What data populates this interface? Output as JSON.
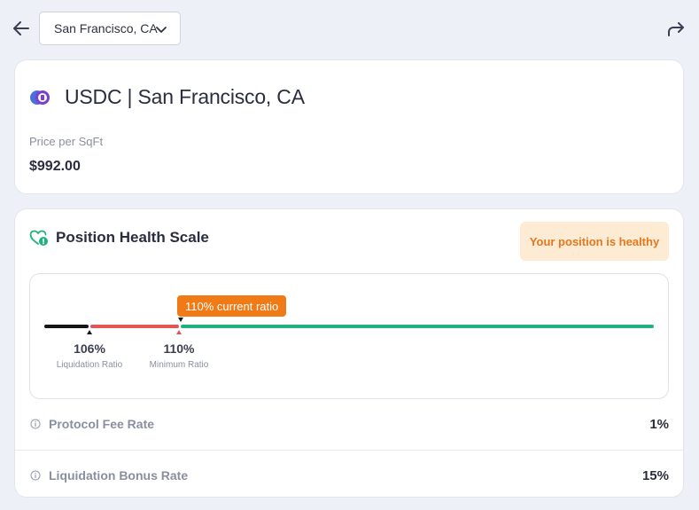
{
  "header": {
    "location_select": {
      "selected": "San Francisco, CA"
    },
    "back_icon": "arrow-left-icon",
    "share_icon": "share-forward-icon"
  },
  "asset": {
    "title": "USDC | San Francisco, CA",
    "price_label": "Price per SqFt",
    "price_value": "$992.00",
    "token_icon": "usdc-token-icon"
  },
  "health": {
    "title": "Position Health Scale",
    "status_badge": "Your position is healthy",
    "current_ratio_label": "110% current ratio",
    "markers": [
      {
        "value": "106%",
        "label": "Liquidation Ratio"
      },
      {
        "value": "110%",
        "label": "Minimum Ratio"
      }
    ],
    "colors": {
      "liquidation": "#151515",
      "danger": "#e25555",
      "healthy": "#22b07d",
      "current": "#f07a16",
      "badge_text": "#e5771e",
      "badge_bg": "#fdebd4"
    }
  },
  "rates": [
    {
      "label": "Protocol Fee Rate",
      "value": "1%"
    },
    {
      "label": "Liquidation Bonus Rate",
      "value": "15%"
    }
  ]
}
